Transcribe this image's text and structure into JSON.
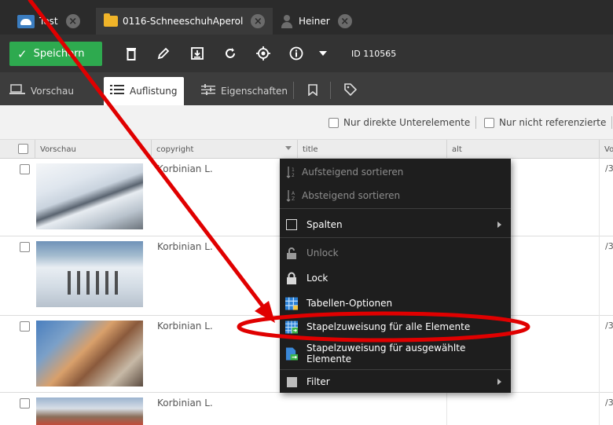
{
  "tabs": [
    {
      "label": "Test",
      "icon": "cloud-icon"
    },
    {
      "label": "0116-SchneeschuhAperol",
      "icon": "folder-icon"
    },
    {
      "label": "Heiner",
      "icon": "user-icon"
    }
  ],
  "tab_close_glyph": "×",
  "toolbar": {
    "save_label": "Speichern",
    "id_label": "ID 110565",
    "icons": [
      "delete-icon",
      "edit-icon",
      "download-icon",
      "reload-icon",
      "locate-icon",
      "info-icon",
      "dropdown-icon"
    ]
  },
  "view_tabs": [
    {
      "label": "Vorschau",
      "icon": "preview-icon"
    },
    {
      "label": "Auflistung",
      "icon": "list-icon",
      "active": true
    },
    {
      "label": "Eigenschaften",
      "icon": "properties-icon"
    },
    {
      "label": "",
      "icon": "bookmark-icon"
    },
    {
      "label": "",
      "icon": "tag-icon"
    }
  ],
  "filters": {
    "direct_children": "Nur direkte Unterelemente",
    "unreferenced": "Nur nicht referenzierte"
  },
  "grid": {
    "columns": [
      "Vorschau",
      "copyright",
      "title",
      "alt",
      "Vo"
    ],
    "rows": [
      {
        "copyright": "Korbinian L.",
        "path": "/3"
      },
      {
        "copyright": "Korbinian L.",
        "path": "/3"
      },
      {
        "copyright": "Korbinian L.",
        "path": "/3"
      },
      {
        "copyright": "Korbinian L.",
        "path": "/3"
      }
    ]
  },
  "context_menu": {
    "sort_asc": "Aufsteigend sortieren",
    "sort_desc": "Absteigend sortieren",
    "columns": "Spalten",
    "unlock": "Unlock",
    "lock": "Lock",
    "table_options": "Tabellen-Optionen",
    "batch_all": "Stapelzuweisung für alle Elemente",
    "batch_selected": "Stapelzuweisung für ausgewählte Elemente",
    "filter": "Filter"
  },
  "colors": {
    "save_green": "#2eaa4f",
    "menu_bg": "#1e1e1e",
    "annotation_red": "#e00000"
  }
}
